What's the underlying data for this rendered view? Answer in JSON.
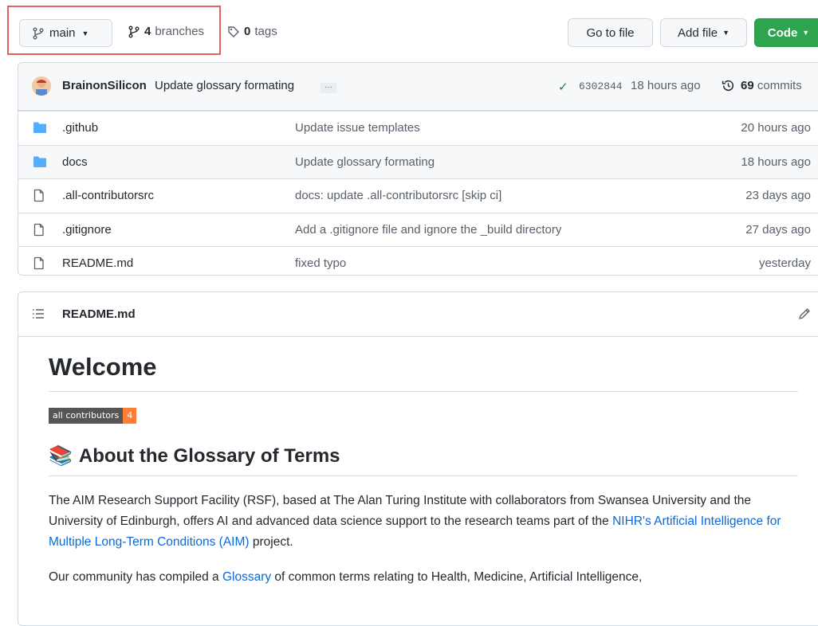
{
  "toolbar": {
    "branch": "main",
    "branches_count": "4",
    "branches_label": "branches",
    "tags_count": "0",
    "tags_label": "tags",
    "goto_file": "Go to file",
    "add_file": "Add file",
    "code": "Code"
  },
  "latest_commit": {
    "author": "BrainonSilicon",
    "message": "Update glossary formating",
    "ellipsis": "…",
    "sha": "6302844",
    "time": "18 hours ago",
    "commits_count": "69",
    "commits_label": "commits"
  },
  "files": [
    {
      "name": ".github",
      "type": "folder",
      "commit": "Update issue templates",
      "age": "20 hours ago"
    },
    {
      "name": "docs",
      "type": "folder",
      "commit": "Update glossary formating",
      "age": "18 hours ago"
    },
    {
      "name": ".all-contributorsrc",
      "type": "file",
      "commit": "docs: update .all-contributorsrc [skip ci]",
      "age": "23 days ago"
    },
    {
      "name": ".gitignore",
      "type": "file",
      "commit": "Add a .gitignore file and ignore the _build directory",
      "age": "27 days ago"
    },
    {
      "name": "README.md",
      "type": "file",
      "commit": "fixed typo",
      "age": "yesterday"
    }
  ],
  "readme": {
    "filename": "README.md",
    "heading": "Welcome",
    "badge_label": "all contributors",
    "badge_count": "4",
    "section_emoji": "📚",
    "section_heading": "About the Glossary of Terms",
    "para1_before": "The AIM Research Support Facility (RSF), based at The Alan Turing Institute with collaborators from Swansea University and the University of Edinburgh, offers AI and advanced data science support to the research teams part of the ",
    "para1_link": "NIHR's Artificial Intelligence for Multiple Long-Term Conditions (AIM)",
    "para1_after": " project.",
    "para2_before": "Our community has compiled a ",
    "para2_link": "Glossary",
    "para2_after": " of common terms relating to Health, Medicine, Artificial Intelligence,"
  },
  "colors": {
    "accent_green": "#2da44e",
    "link_blue": "#0969da",
    "folder_blue": "#54aeff",
    "highlight_red": "#e0615f",
    "badge_orange": "#fe7d37"
  }
}
